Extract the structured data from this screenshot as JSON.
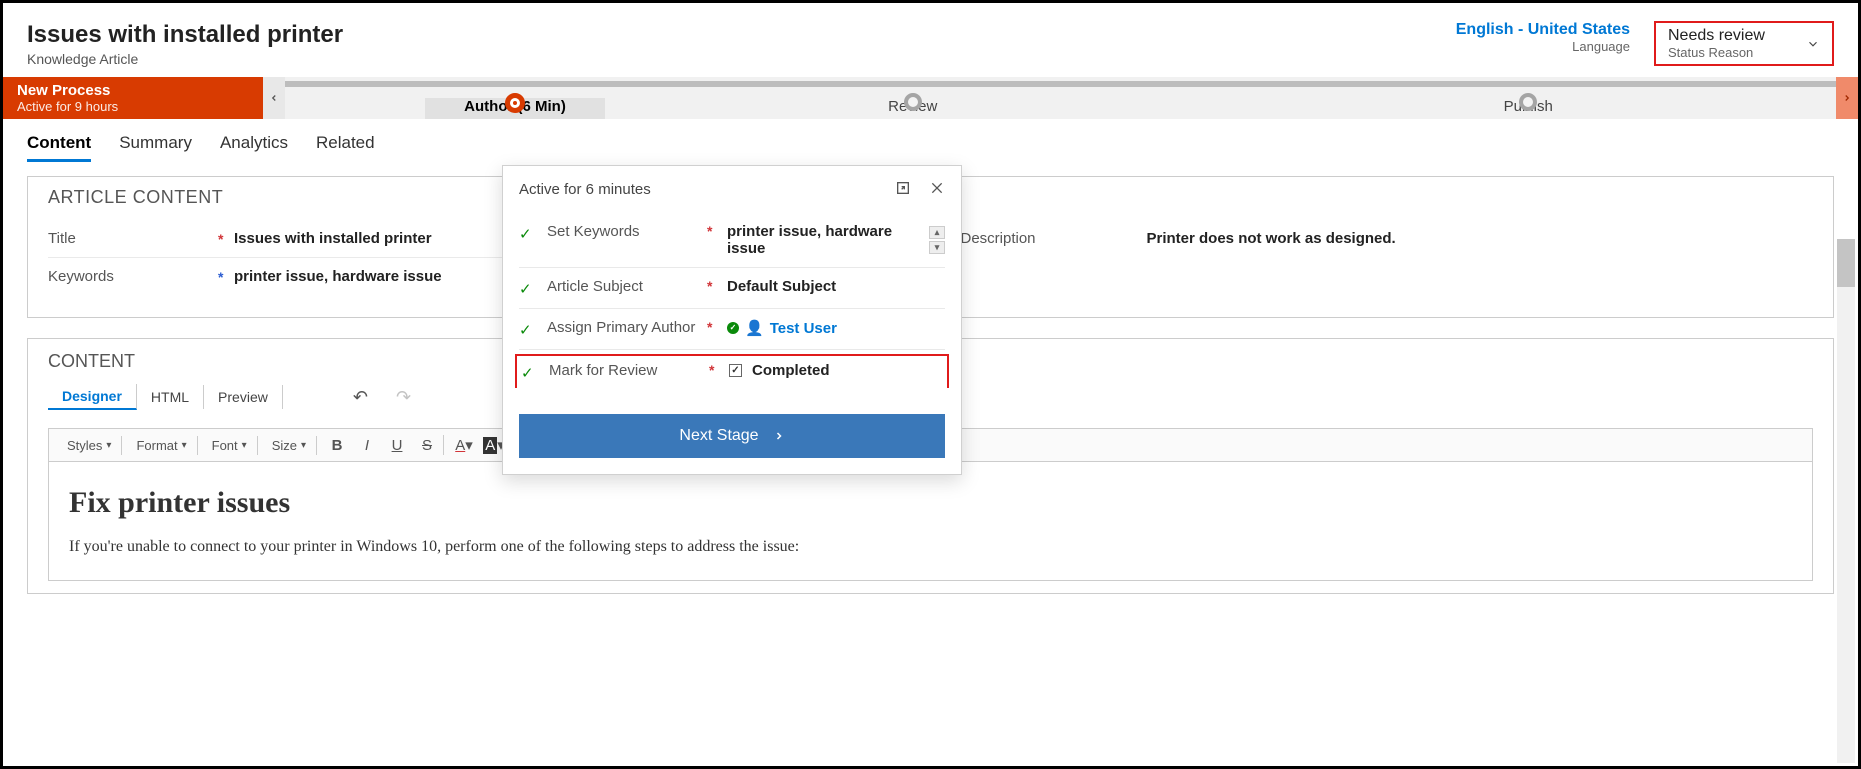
{
  "header": {
    "title": "Issues with installed printer",
    "subtitle": "Knowledge Article",
    "language_value": "English - United States",
    "language_label": "Language",
    "status_value": "Needs review",
    "status_label": "Status Reason"
  },
  "process": {
    "name": "New Process",
    "active_for": "Active for 9 hours",
    "stages": {
      "author": "Author  (6 Min)",
      "review": "Review",
      "publish": "Publish"
    }
  },
  "tabs": {
    "content": "Content",
    "summary": "Summary",
    "analytics": "Analytics",
    "related": "Related"
  },
  "article": {
    "section_title": "ARTICLE CONTENT",
    "title_label": "Title",
    "title_value": "Issues with installed printer",
    "keywords_label": "Keywords",
    "keywords_value": "printer issue, hardware issue",
    "description_label": "Description",
    "description_value": "Printer does not work as designed."
  },
  "content": {
    "section_title": "CONTENT",
    "subtabs": {
      "designer": "Designer",
      "html": "HTML",
      "preview": "Preview"
    },
    "toolbar": {
      "styles": "Styles",
      "format": "Format",
      "font": "Font",
      "size": "Size"
    },
    "body_heading": "Fix printer issues",
    "body_para": "If you're unable to connect to your printer in Windows 10, perform one of the following steps to address the issue:"
  },
  "flyout": {
    "title": "Active for 6 minutes",
    "rows": {
      "keywords_label": "Set Keywords",
      "keywords_value": "printer issue, hardware issue",
      "subject_label": "Article Subject",
      "subject_value": "Default Subject",
      "author_label": "Assign Primary Author",
      "author_value": "Test User",
      "mark_label": "Mark for Review",
      "mark_value": "Completed"
    },
    "next_stage": "Next Stage"
  }
}
